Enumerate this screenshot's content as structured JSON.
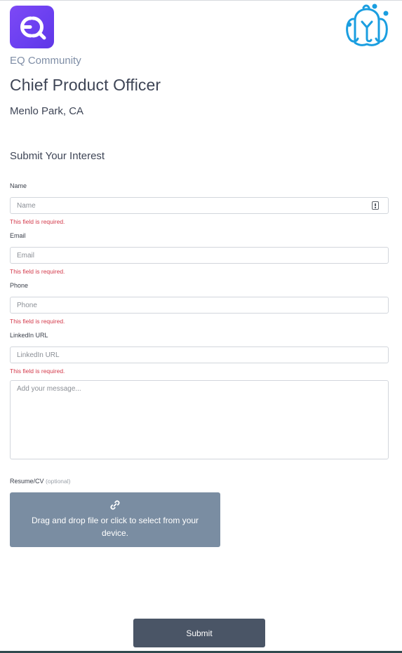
{
  "brand": {
    "logo_text": "EQ",
    "community_name": "EQ Community"
  },
  "job": {
    "title": "Chief Product Officer",
    "location": "Menlo Park, CA"
  },
  "form": {
    "heading": "Submit Your Interest",
    "required_error": "This field is required.",
    "fields": {
      "name": {
        "label": "Name",
        "placeholder": "Name"
      },
      "email": {
        "label": "Email",
        "placeholder": "Email"
      },
      "phone": {
        "label": "Phone",
        "placeholder": "Phone"
      },
      "linkedin": {
        "label": "LinkedIn URL",
        "placeholder": "LinkedIn URL"
      }
    },
    "message": {
      "placeholder": "Add your message..."
    },
    "resume": {
      "label": "Resume/CV",
      "optional": "(optional)",
      "dropzone_text": "Drag and drop file or click to select from your device."
    },
    "submit_label": "Submit"
  },
  "icons": {
    "field_icon": "autofill-alert-icon",
    "attach_icon": "paperclip-icon",
    "mascot": "elephant-mascot-icon"
  },
  "colors": {
    "brand_purple": "#7d49f5",
    "error": "#d33a4b",
    "dropzone": "#7a8da2",
    "submit": "#4a5566",
    "mascot_blue": "#1a9ee0"
  }
}
